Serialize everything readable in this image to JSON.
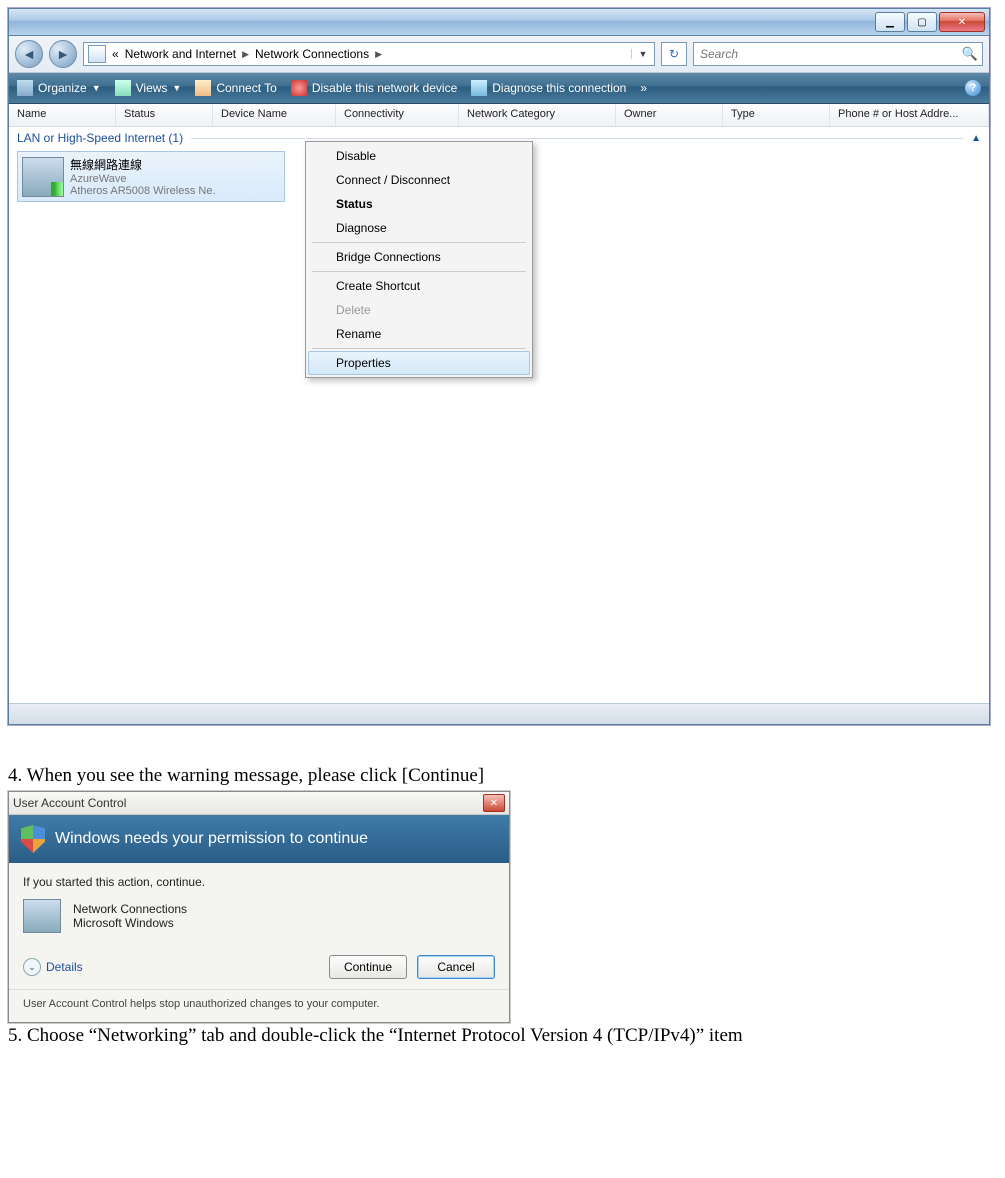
{
  "explorer": {
    "breadcrumb": {
      "prefix": "«",
      "items": [
        "Network and Internet",
        "Network Connections"
      ]
    },
    "search_placeholder": "Search",
    "cmdbar": {
      "organize": "Organize",
      "views": "Views",
      "connect_to": "Connect To",
      "disable": "Disable this network device",
      "diagnose": "Diagnose this connection",
      "overflow": "»"
    },
    "columns": [
      "Name",
      "Status",
      "Device Name",
      "Connectivity",
      "Network Category",
      "Owner",
      "Type",
      "Phone # or Host Addre..."
    ],
    "group_header": "LAN or High-Speed Internet (1)",
    "connection": {
      "name": "無線網路連線",
      "network": "AzureWave",
      "device": "Atheros AR5008 Wireless Ne."
    },
    "context_menu": {
      "disable": "Disable",
      "connect": "Connect / Disconnect",
      "status": "Status",
      "diagnose": "Diagnose",
      "bridge": "Bridge Connections",
      "shortcut": "Create Shortcut",
      "delete": "Delete",
      "rename": "Rename",
      "properties": "Properties"
    }
  },
  "step4": "4. When you see the warning message, please click [Continue]",
  "uac": {
    "title": "User Account Control",
    "banner": "Windows needs your permission to continue",
    "line1": "If you started this action, continue.",
    "prog_name": "Network Connections",
    "prog_vendor": "Microsoft Windows",
    "details": "Details",
    "continue": "Continue",
    "cancel": "Cancel",
    "footer": "User Account Control helps stop unauthorized changes to your computer."
  },
  "step5": "5. Choose “Networking” tab and double-click the “Internet Protocol Version 4 (TCP/IPv4)” item"
}
